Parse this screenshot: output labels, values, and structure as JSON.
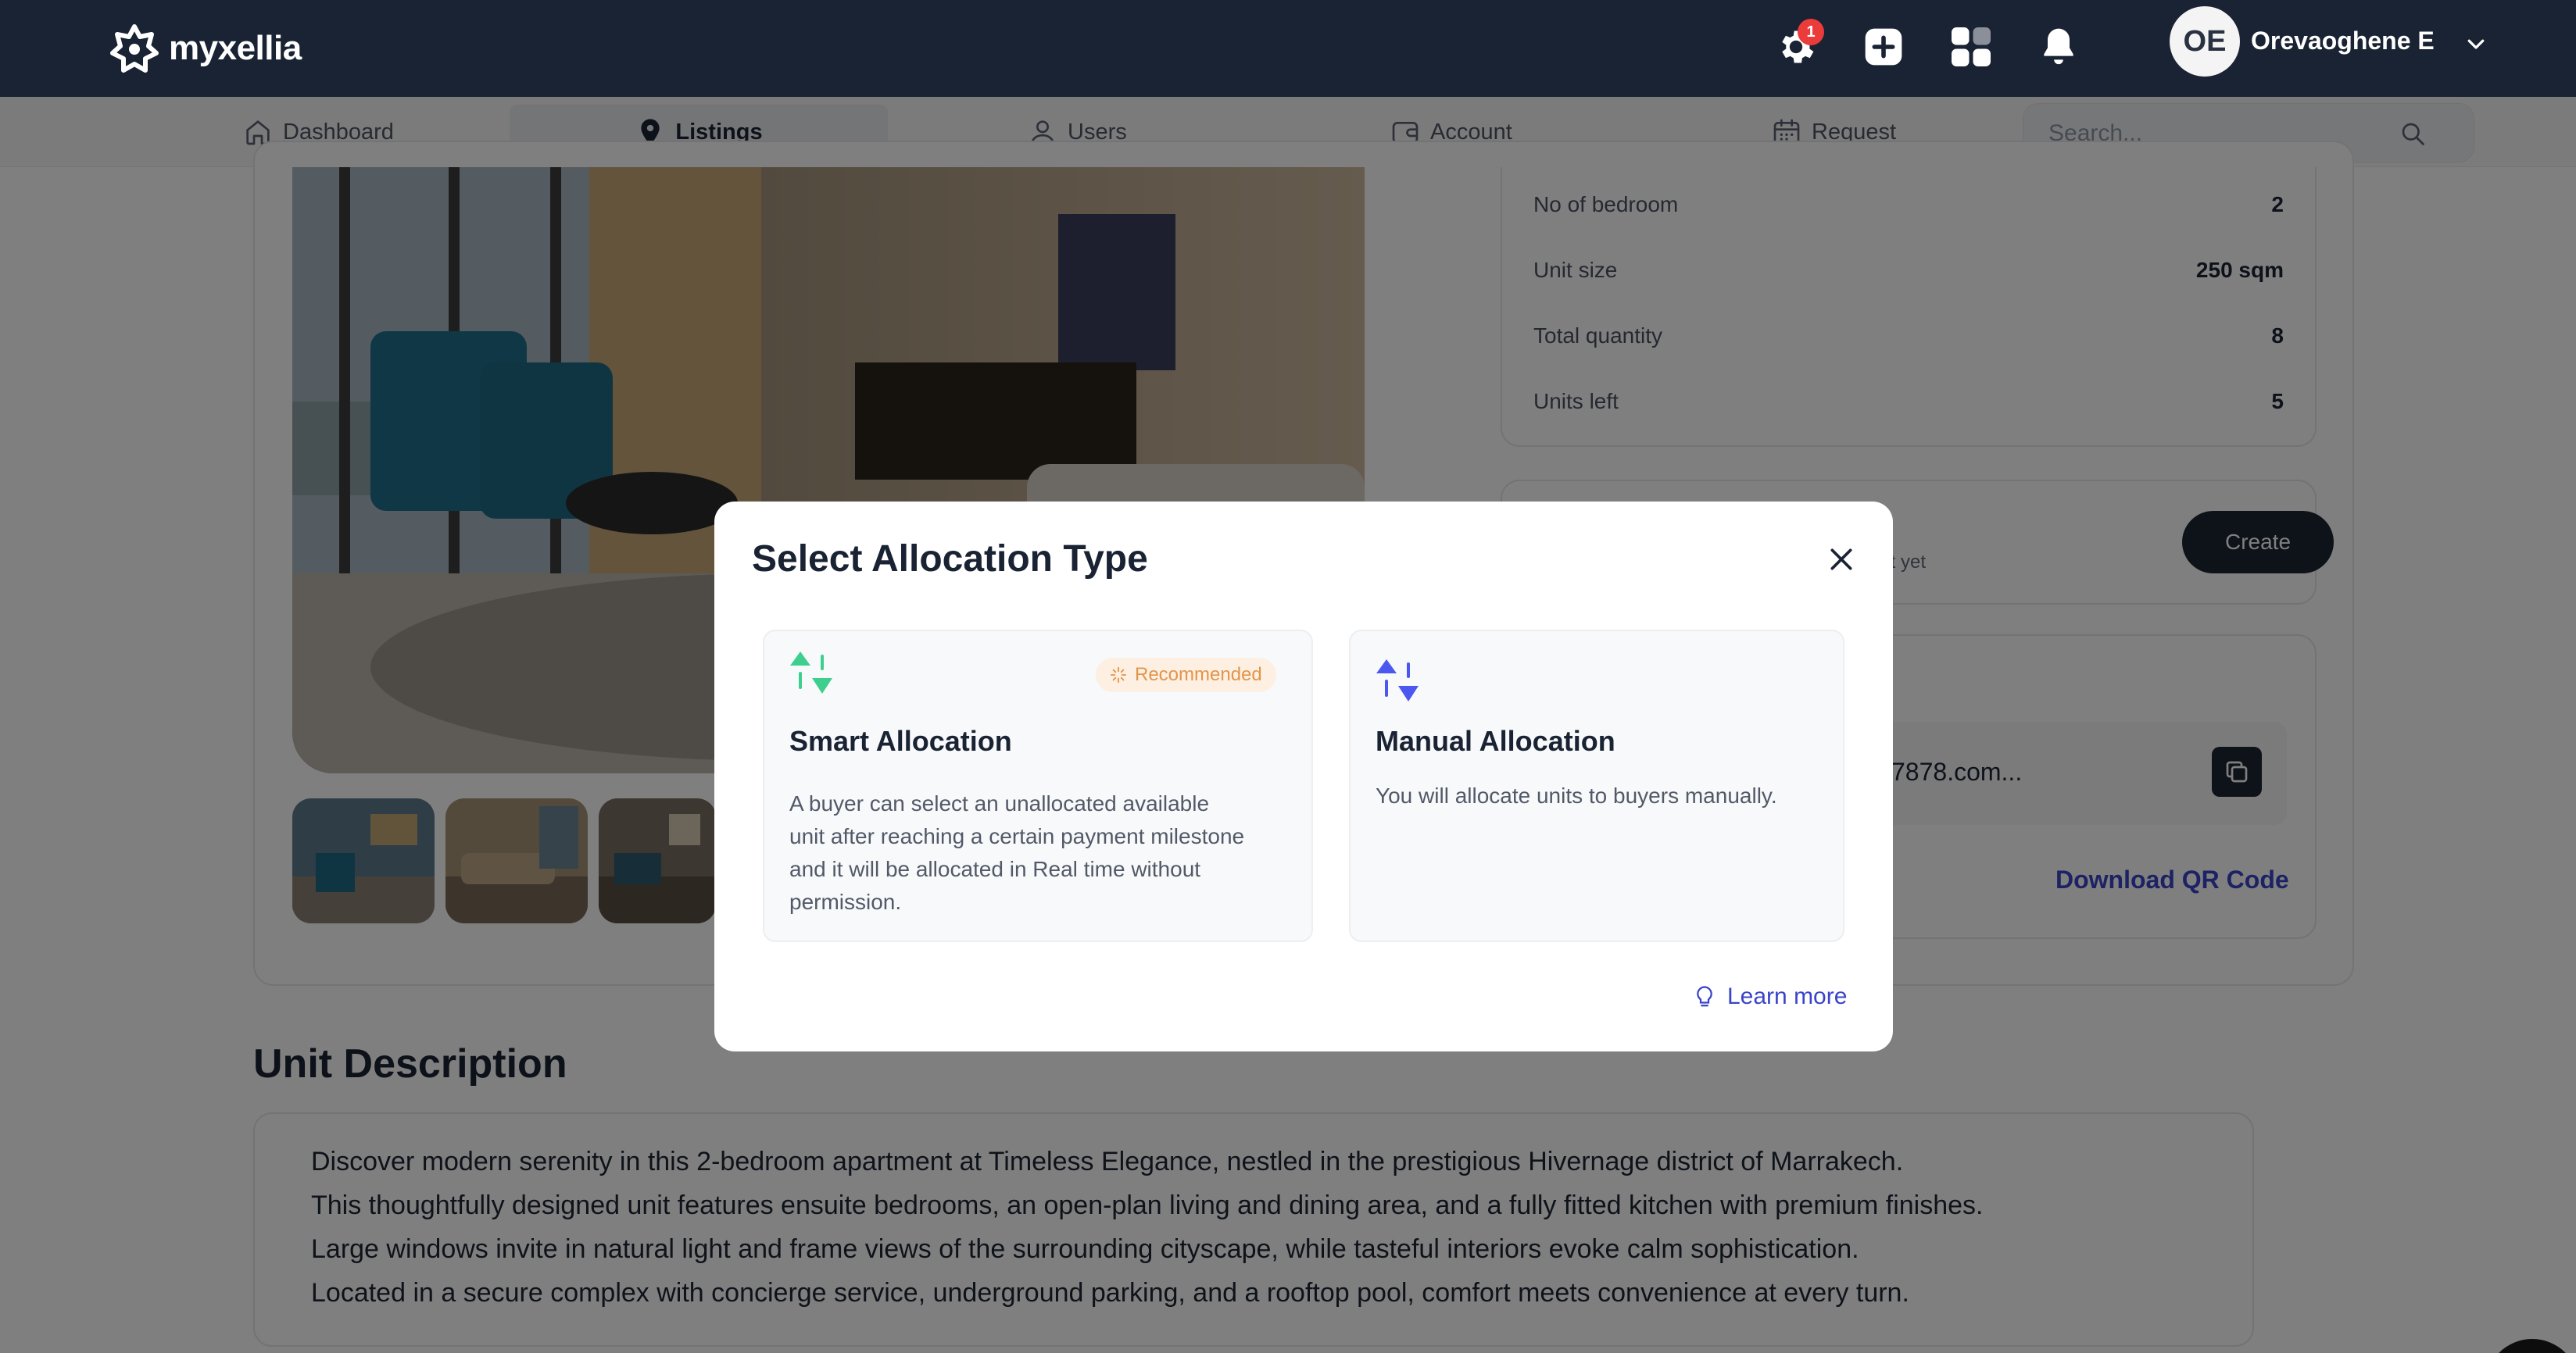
{
  "app": {
    "brand": "myxellia"
  },
  "header": {
    "settings_badge": "1",
    "user": {
      "initials": "OE",
      "name": "Orevaoghene E"
    }
  },
  "nav": {
    "items": [
      {
        "label": "Dashboard",
        "icon": "home-icon"
      },
      {
        "label": "Listings",
        "icon": "location-pin-icon",
        "active": true
      },
      {
        "label": "Users",
        "icon": "user-icon"
      },
      {
        "label": "Account",
        "icon": "wallet-icon"
      },
      {
        "label": "Request",
        "icon": "calendar-icon"
      }
    ],
    "search_placeholder": "Search..."
  },
  "details": {
    "rows": [
      {
        "label": "No of bedroom",
        "value": "2"
      },
      {
        "label": "Unit size",
        "value": "250 sqm"
      },
      {
        "label": "Total quantity",
        "value": "8"
      },
      {
        "label": "Units left",
        "value": "5"
      }
    ]
  },
  "allocation_card": {
    "partial_text": "nit yet",
    "create_label": "Create"
  },
  "share_card": {
    "link_text": "7878.com...",
    "qr_label": "Download QR Code"
  },
  "description": {
    "heading": "Unit Description",
    "lines": [
      "Discover modern serenity in this 2-bedroom apartment at Timeless Elegance, nestled in the prestigious Hivernage district of Marrakech.",
      "This thoughtfully designed unit features ensuite bedrooms, an open-plan living and dining area, and a fully fitted kitchen with premium finishes.",
      "Large windows invite in natural light and frame views of the surrounding cityscape, while tasteful interiors evoke calm sophistication.",
      "Located in a secure complex with concierge service, underground parking, and a rooftop pool, comfort meets convenience at every turn."
    ]
  },
  "modal": {
    "title": "Select Allocation Type",
    "options": [
      {
        "title": "Smart Allocation",
        "badge": "Recommended",
        "description_lines": [
          "A buyer can select an unallocated available",
          "unit after reaching a certain payment milestone",
          "and it will be allocated in Real time without",
          "permission."
        ],
        "icon_color": "#3ecf8e"
      },
      {
        "title": "Manual Allocation",
        "description_lines": [
          "You will allocate units to buyers manually."
        ],
        "icon_color": "#4c57f0"
      }
    ],
    "learn_more": "Learn more"
  },
  "colors": {
    "header_bg": "#1a2333",
    "accent_link": "#3a44c8",
    "badge_red": "#ec3b3b",
    "recommended_bg": "#fdefe1",
    "recommended_text": "#e2954a"
  }
}
